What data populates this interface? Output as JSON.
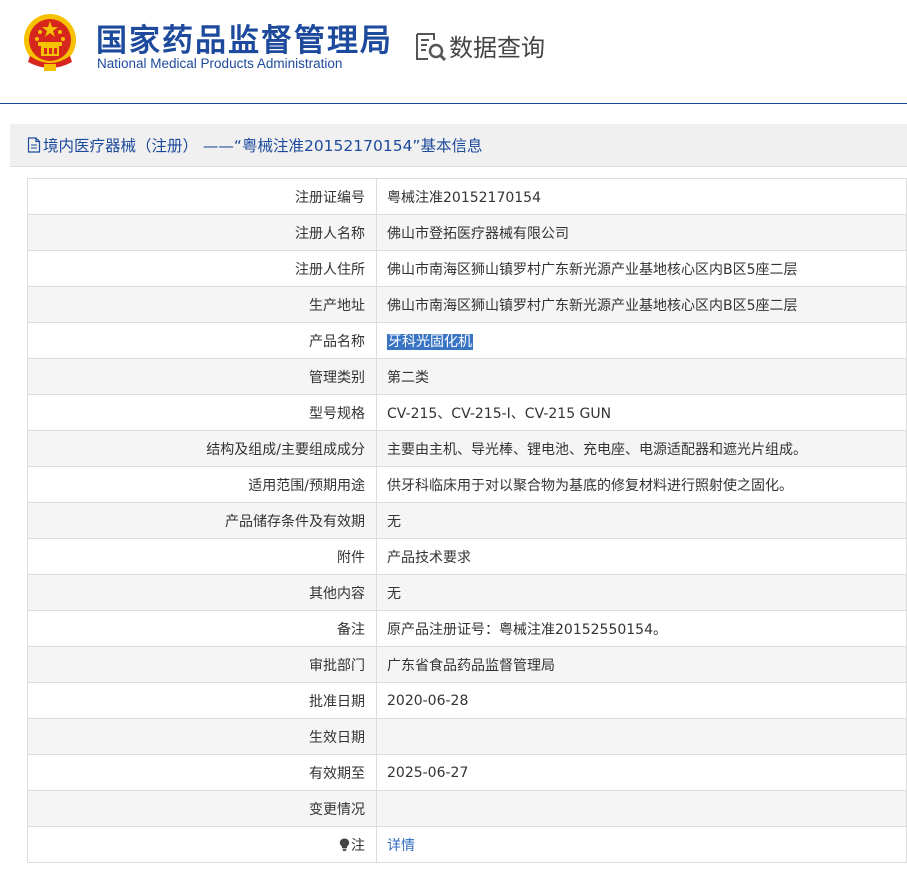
{
  "header": {
    "logo_cn": "国家药品监督管理局",
    "logo_en": "National Medical Products Administration",
    "query_label": "数据查询"
  },
  "panel": {
    "title": "境内医疗器械（注册） ——“粤械注准20152170154”基本信息"
  },
  "rows": [
    {
      "label": "注册证编号",
      "value": "粤械注准20152170154"
    },
    {
      "label": "注册人名称",
      "value": "佛山市登拓医疗器械有限公司"
    },
    {
      "label": "注册人住所",
      "value": "佛山市南海区狮山镇罗村广东新光源产业基地核心区内B区5座二层"
    },
    {
      "label": "生产地址",
      "value": "佛山市南海区狮山镇罗村广东新光源产业基地核心区内B区5座二层"
    },
    {
      "label": "产品名称",
      "value": "牙科光固化机"
    },
    {
      "label": "管理类别",
      "value": "第二类"
    },
    {
      "label": "型号规格",
      "value": "CV-215、CV-215-I、CV-215 GUN"
    },
    {
      "label": "结构及组成/主要组成成分",
      "value": "主要由主机、导光棒、锂电池、充电座、电源适配器和遮光片组成。"
    },
    {
      "label": "适用范围/预期用途",
      "value": "供牙科临床用于对以聚合物为基底的修复材料进行照射使之固化。"
    },
    {
      "label": "产品储存条件及有效期",
      "value": "无"
    },
    {
      "label": "附件",
      "value": "产品技术要求"
    },
    {
      "label": "其他内容",
      "value": "无"
    },
    {
      "label": "备注",
      "value": "原产品注册证号：粤械注准20152550154。"
    },
    {
      "label": "审批部门",
      "value": "广东省食品药品监督管理局"
    },
    {
      "label": "批准日期",
      "value": "2020-06-28"
    },
    {
      "label": "生效日期",
      "value": ""
    },
    {
      "label": "有效期至",
      "value": "2025-06-27"
    },
    {
      "label": "变更情况",
      "value": ""
    },
    {
      "label": "注",
      "value": "详情"
    }
  ],
  "colors": {
    "brand_blue": "#1d4a9c",
    "link_blue": "#2f6bbf",
    "selection_highlight": "#3a75c4"
  },
  "icons": {
    "emblem": "national-emblem-icon",
    "query": "data-query-icon",
    "doc": "document-icon",
    "note": "lightbulb-icon"
  }
}
